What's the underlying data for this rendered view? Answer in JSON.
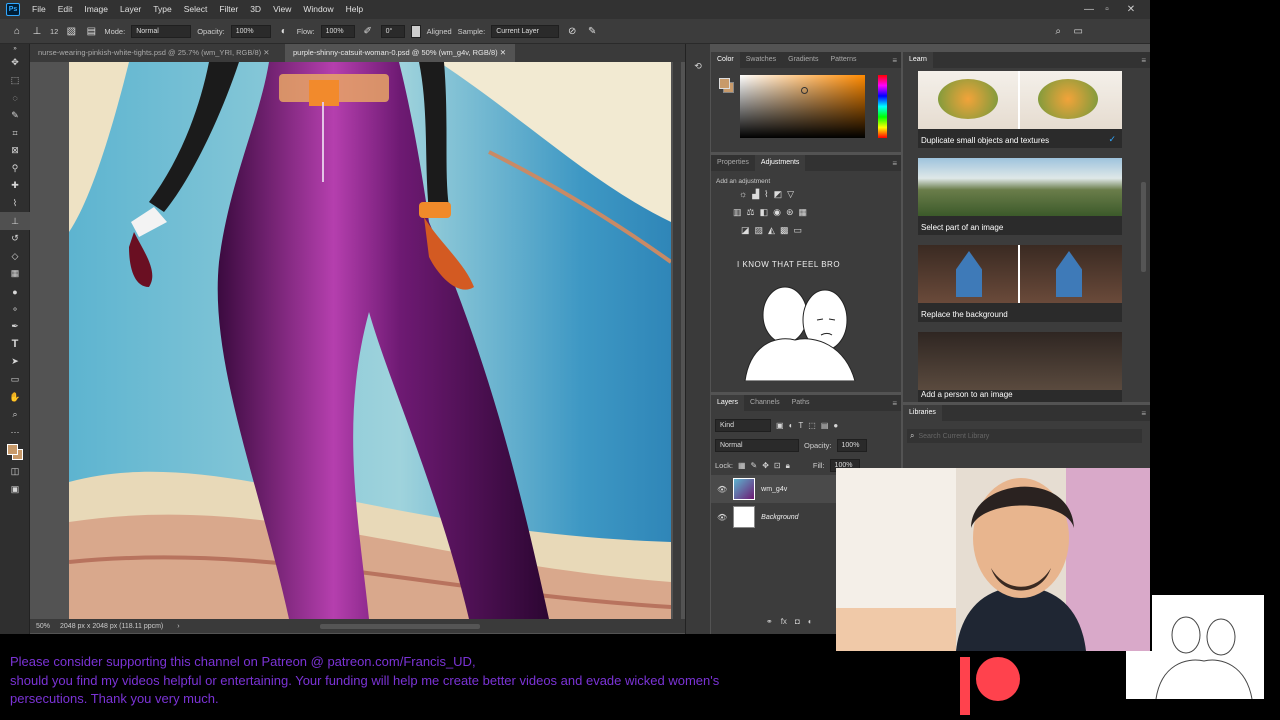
{
  "menu": {
    "items": [
      "File",
      "Edit",
      "Image",
      "Layer",
      "Type",
      "Select",
      "Filter",
      "3D",
      "View",
      "Window",
      "Help"
    ]
  },
  "options": {
    "brush_size": "12",
    "mode_label": "Mode:",
    "mode_value": "Normal",
    "opacity_label": "Opacity:",
    "opacity_value": "100%",
    "flow_label": "Flow:",
    "flow_value": "100%",
    "angle_value": "0°",
    "aligned_label": "Aligned",
    "sample_label": "Sample:",
    "sample_value": "Current Layer"
  },
  "tabs": [
    {
      "label": "nurse-wearing-pinkish-white-tights.psd @ 25.7% (wm_YRI, RGB/8)"
    },
    {
      "label": "purple-shinny-catsuit-woman-0.psd @ 50% (wm_g4v, RGB/8)"
    }
  ],
  "status": {
    "zoom": "50%",
    "doc_info": "2048 px x 2048 px (118.11 ppcm)"
  },
  "color_panel": {
    "tabs": [
      "Color",
      "Swatches",
      "Gradients",
      "Patterns"
    ],
    "foreground": "#c89a6a",
    "picker_hue": "#ff8a00"
  },
  "adjust_panel": {
    "tabs": [
      "Properties",
      "Adjustments"
    ],
    "add_label": "Add an adjustment",
    "meme_caption": "I KNOW THAT FEEL BRO"
  },
  "layers_panel": {
    "tabs": [
      "Layers",
      "Channels",
      "Paths"
    ],
    "kind_label": "Kind",
    "blend_mode": "Normal",
    "opacity_label": "Opacity:",
    "opacity_value": "100%",
    "lock_label": "Lock:",
    "fill_label": "Fill:",
    "fill_value": "100%",
    "layers": [
      {
        "name": "wm_g4v"
      },
      {
        "name": "Background"
      }
    ]
  },
  "learn_panel": {
    "title": "Learn",
    "cards": [
      {
        "label": "Duplicate small objects and textures"
      },
      {
        "label": "Select part of an image"
      },
      {
        "label": "Replace the background"
      },
      {
        "label": "Add a person to an image"
      }
    ]
  },
  "libraries_panel": {
    "title": "Libraries",
    "search_placeholder": "Search Current Library"
  },
  "banner": {
    "line1": "Please consider supporting this channel on Patreon @ patreon.com/Francis_UD,",
    "line2": "should you find my videos helpful or entertaining. Your funding will help me create better videos and evade wicked women's",
    "line3": "persecutions.  Thank you very much."
  }
}
